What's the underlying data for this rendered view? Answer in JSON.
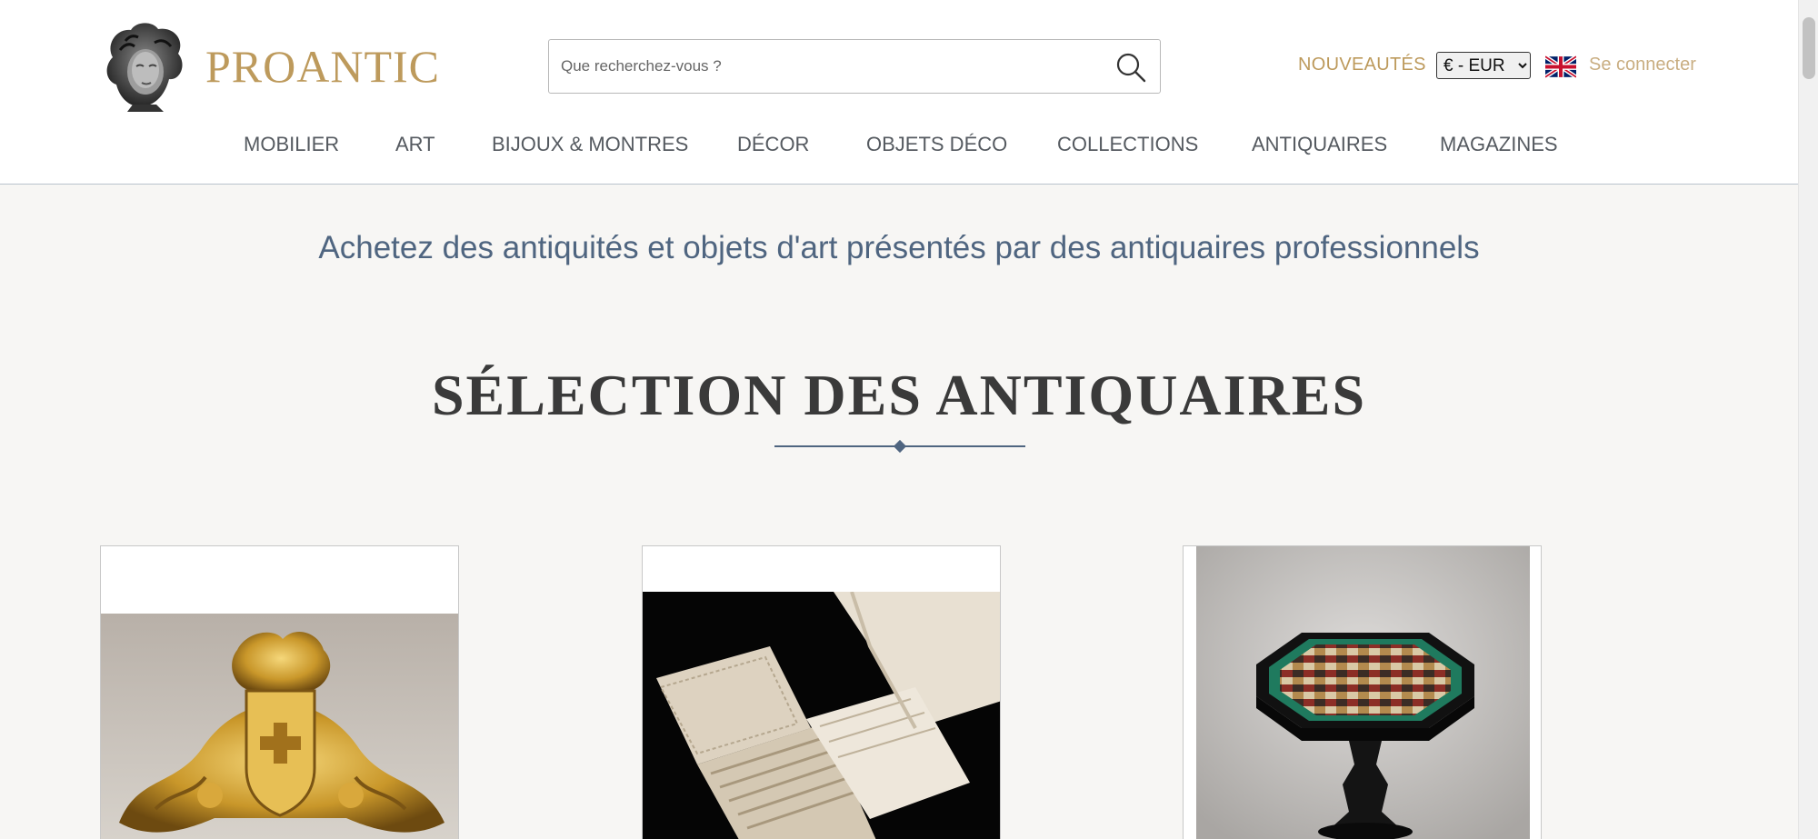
{
  "brand": {
    "name": "PROANTIC",
    "logo_icon": "bust-sculpture-icon"
  },
  "search": {
    "placeholder": "Que recherchez-vous ?",
    "icon": "search-icon"
  },
  "header": {
    "new_label": "NOUVEAUTÉS",
    "currency": {
      "selected": "€ - EUR"
    },
    "language_flag": "uk-flag-icon",
    "login_label": "Se connecter"
  },
  "nav": {
    "items": [
      {
        "label": "MOBILIER"
      },
      {
        "label": "ART"
      },
      {
        "label": "BIJOUX & MONTRES"
      },
      {
        "label": "DÉCOR"
      },
      {
        "label": "OBJETS DÉCO"
      },
      {
        "label": "COLLECTIONS"
      },
      {
        "label": "ANTIQUAIRES"
      },
      {
        "label": "MAGAZINES"
      }
    ]
  },
  "main": {
    "tagline": "Achetez des antiquités et objets d'art présentés par des antiquaires professionnels",
    "section_title": "SÉLECTION DES ANTIQUAIRES"
  },
  "colors": {
    "gold": "#bd9a5c",
    "gold_light": "#c9ae82",
    "slate": "#4f6580",
    "background": "#f7f6f4"
  },
  "products": [
    {
      "image": "gilded-coat-of-arms-carving"
    },
    {
      "image": "lace-linen-napkins"
    },
    {
      "image": "pietra-dura-octagonal-table"
    }
  ]
}
